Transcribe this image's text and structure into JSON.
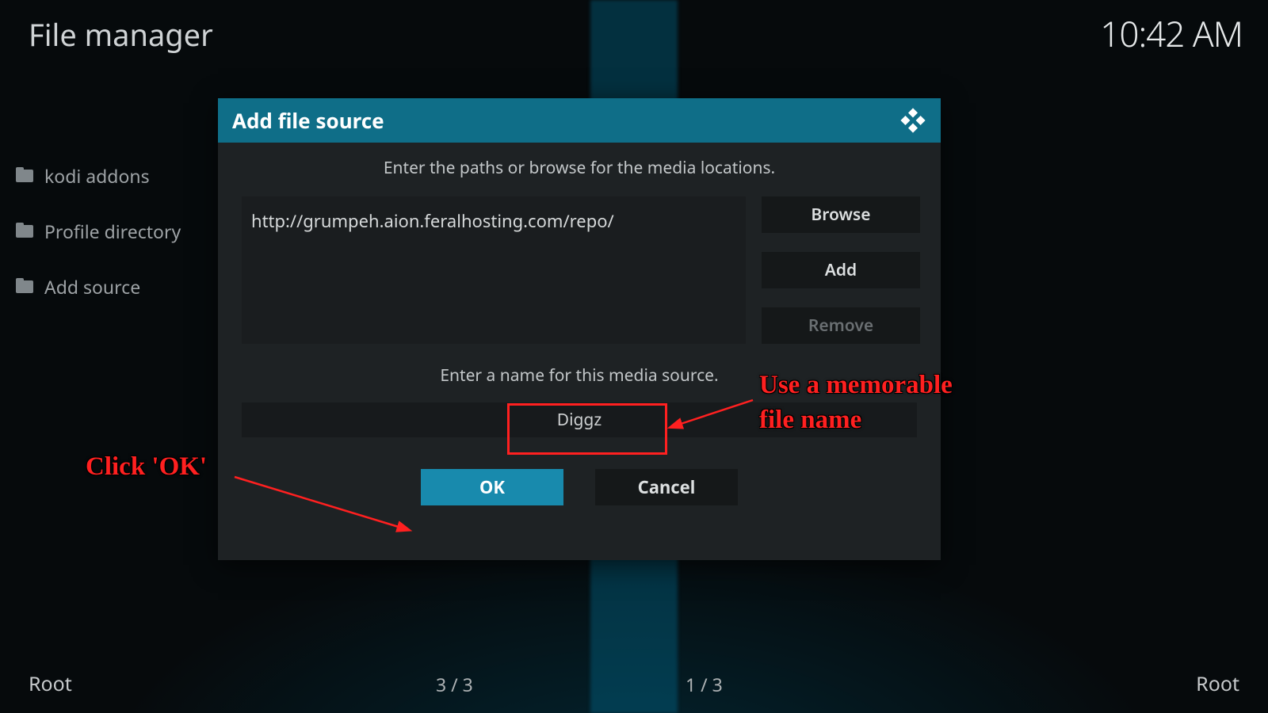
{
  "header": {
    "title": "File manager",
    "time": "10:42 AM"
  },
  "side_items": [
    {
      "label": "kodi addons"
    },
    {
      "label": "Profile directory"
    },
    {
      "label": "Add source"
    }
  ],
  "dialog": {
    "title": "Add file source",
    "instruction_paths": "Enter the paths or browse for the media locations.",
    "path_value": "http://grumpeh.aion.feralhosting.com/repo/",
    "browse_label": "Browse",
    "add_label": "Add",
    "remove_label": "Remove",
    "instruction_name": "Enter a name for this media source.",
    "name_value": "Diggz",
    "ok_label": "OK",
    "cancel_label": "Cancel"
  },
  "status": {
    "left": "Root",
    "mid_left": "3 / 3",
    "mid_right": "1 / 3",
    "right": "Root"
  },
  "annotations": {
    "click_ok": "Click 'OK'",
    "memorable_1": "Use a memorable",
    "memorable_2": "file name"
  }
}
